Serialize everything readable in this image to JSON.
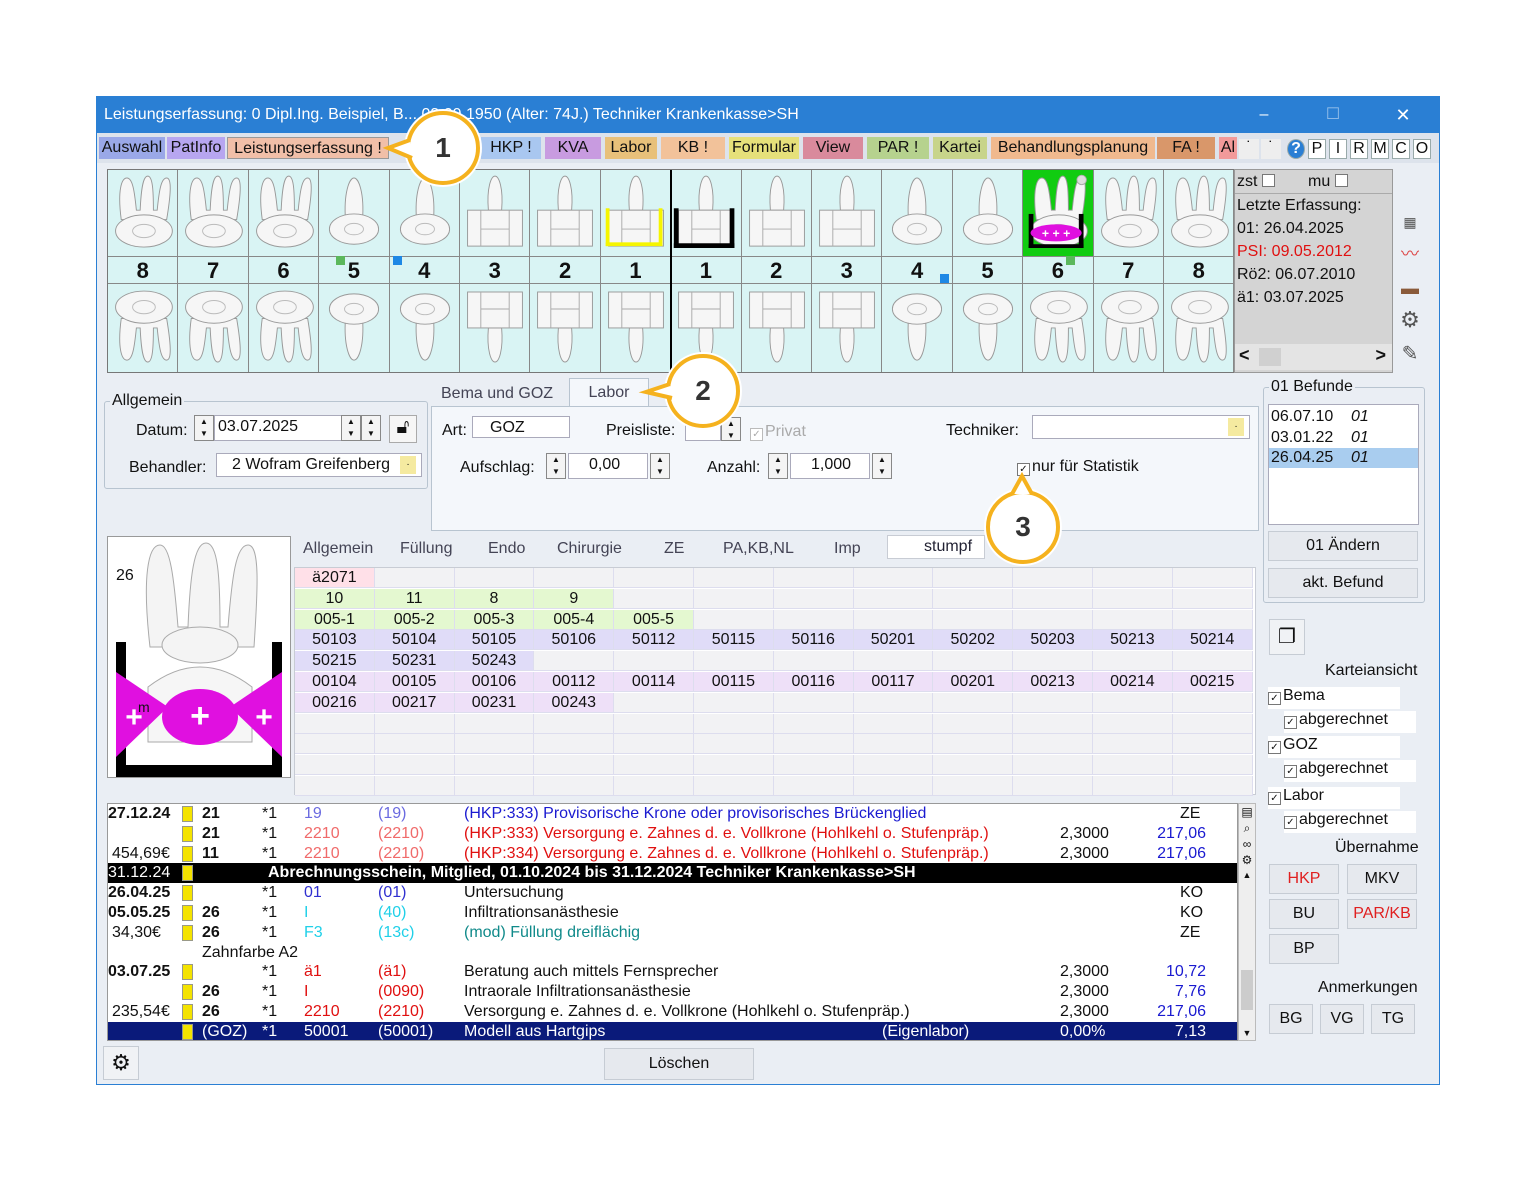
{
  "window": {
    "title": "Leistungserfassung: 0  Dipl.Ing. Beispiel, B... 03.09.1950 (Alter: 74J.)  Techniker Krankenkasse>SH",
    "min": "–",
    "max": "☐",
    "close": "✕"
  },
  "tabs": [
    {
      "label": "Auswahl",
      "color": "#9aa8e8"
    },
    {
      "label": "PatInfo",
      "color": "#b7a6f0"
    },
    {
      "label": "Leistungserfassung !",
      "color": "#f1bfa8"
    },
    {
      "label": "HKP !",
      "color": "#a9c7f0"
    },
    {
      "label": "KVA",
      "color": "#c89be0"
    },
    {
      "label": "Labor",
      "color": "#e8c07a"
    },
    {
      "label": "KB !",
      "color": "#f2c29a"
    },
    {
      "label": "Formular",
      "color": "#e6e07a"
    },
    {
      "label": "View",
      "color": "#d98a9c"
    },
    {
      "label": "PAR !",
      "color": "#b6d28e"
    },
    {
      "label": "Kartei",
      "color": "#c8d48a"
    },
    {
      "label": "Behandlungsplanung",
      "color": "#f0b98e"
    },
    {
      "label": "FA !",
      "color": "#d9976a"
    },
    {
      "label": "Al",
      "color": "#f29a9a"
    }
  ],
  "tab_small": [
    "˙",
    "˙"
  ],
  "tab_right": [
    "?",
    "P",
    "I",
    "R",
    "M",
    "C",
    "O"
  ],
  "teeth": {
    "upper_numbers": [
      "8",
      "7",
      "6",
      "5",
      "4",
      "3",
      "2",
      "1",
      "1",
      "2",
      "3",
      "4",
      "5",
      "6",
      "7",
      "8"
    ],
    "selected_index": 13,
    "marker_colors": {
      "green": "#5cb85c",
      "blue": "#1e88e5",
      "selected_bg": "#11cc11",
      "bridge_yellow": "#f5f500",
      "restoration_magenta": "#e010e0"
    }
  },
  "info": {
    "zst": "zst",
    "mu": "mu",
    "line1": "Letzte Erfassung:",
    "line2": "01: 26.04.2025",
    "line3": "PSI: 09.05.2012",
    "line4": "Rö2: 06.07.2010",
    "line5": "ä1: 03.07.2025",
    "scroll_left": "<",
    "scroll_right": ">"
  },
  "allgemein": {
    "title": "Allgemein",
    "datum_label": "Datum:",
    "datum_value": "03.07.2025",
    "behandler_label": "Behandler:",
    "behandler_value": "2 Wofram Greifenberg"
  },
  "subtabs": {
    "bema_goz": "Bema und GOZ",
    "labor": "Labor"
  },
  "labor": {
    "art_label": "Art:",
    "art_value": "GOZ",
    "preisliste_label": "Preisliste:",
    "privat_label": "Privat",
    "techniker_label": "Techniker:",
    "aufschlag_label": "Aufschlag:",
    "aufschlag_value": "0,00",
    "anzahl_label": "Anzahl:",
    "anzahl_value": "1,000",
    "statistik_label": "nur für Statistik"
  },
  "tooth_preview": {
    "number": "26",
    "surface": "m"
  },
  "code_tabs": [
    "Allgemein",
    "Füllung",
    "Endo",
    "Chirurgie",
    "ZE",
    "PA,KB,NL",
    "Imp",
    "stumpf"
  ],
  "code_grid": [
    {
      "bg": "#ffe0e8",
      "cells": [
        "ä2071"
      ]
    },
    {
      "bg": "#e4f8d0",
      "cells": [
        "10",
        "11",
        "8",
        "9"
      ]
    },
    {
      "bg": "#e4f8d0",
      "cells": [
        "005-1",
        "005-2",
        "005-3",
        "005-4",
        "005-5"
      ]
    },
    {
      "bg": "#e0dcf8",
      "cells": [
        "50103",
        "50104",
        "50105",
        "50106",
        "50112",
        "50115",
        "50116",
        "50201",
        "50202",
        "50203",
        "50213",
        "50214"
      ]
    },
    {
      "bg": "#e0dcf8",
      "cells": [
        "50215",
        "50231",
        "50243"
      ]
    },
    {
      "bg": "#eee0f8",
      "cells": [
        "00104",
        "00105",
        "00106",
        "00112",
        "00114",
        "00115",
        "00116",
        "00117",
        "00201",
        "00213",
        "00214",
        "00215"
      ]
    },
    {
      "bg": "#eee0f8",
      "cells": [
        "00216",
        "00217",
        "00231",
        "00243"
      ]
    }
  ],
  "befunde": {
    "title": "01 Befunde",
    "items": [
      {
        "date": "06.07.10",
        "code": "01"
      },
      {
        "date": "03.01.22",
        "code": "01"
      },
      {
        "date": "26.04.25",
        "code": "01"
      }
    ],
    "btn_aendern": "01 Ändern",
    "btn_akt": "akt. Befund"
  },
  "karteiansicht": {
    "title": "Karteiansicht",
    "bema": "Bema",
    "bema_abg": "abgerechnet",
    "goz": "GOZ",
    "goz_abg": "abgerechnet",
    "labor": "Labor",
    "labor_abg": "abgerechnet"
  },
  "uebernahme": {
    "title": "Übernahme",
    "hkp": "HKP",
    "mkv": "MKV",
    "bu": "BU",
    "parkb": "PAR/KB",
    "bp": "BP"
  },
  "anmerkungen": {
    "title": "Anmerkungen",
    "bg": "BG",
    "vg": "VG",
    "tg": "TG"
  },
  "journal": [
    {
      "date": "27.12.24",
      "tooth": "21",
      "qty": "*1",
      "code": "19",
      "code2": "(19)",
      "text": "(HKP:333) Provisorische Krone oder provisorisches Brückenglied",
      "factor": "",
      "amount": "",
      "type": "ZE",
      "style": "blue"
    },
    {
      "date": "",
      "tooth": "21",
      "qty": "*1",
      "code": "2210",
      "code2": "(2210)",
      "text": "(HKP:333) Versorgung e. Zahnes d. e. Vollkrone (Hohlkehl o. Stufenpräp.)",
      "factor": "2,3000",
      "amount": "217,06",
      "type": "",
      "style": "red"
    },
    {
      "date": "454,69€",
      "tooth": "11",
      "qty": "*1",
      "code": "2210",
      "code2": "(2210)",
      "text": "(HKP:334) Versorgung e. Zahnes d. e. Vollkrone (Hohlkehl o. Stufenpräp.)",
      "factor": "2,3000",
      "amount": "217,06",
      "type": "",
      "style": "red"
    },
    {
      "date": "31.12.24",
      "tooth": "",
      "qty": "",
      "code": "",
      "code2": "",
      "text": "Abrechnungsschein, Mitglied, 01.10.2024 bis 31.12.2024  Techniker Krankenkasse>SH",
      "factor": "",
      "amount": "",
      "type": "",
      "style": "header"
    },
    {
      "date": "26.04.25",
      "tooth": "",
      "qty": "*1",
      "code": "01",
      "code2": "(01)",
      "text": "Untersuchung",
      "factor": "",
      "amount": "",
      "type": "KO",
      "style": "bluecode"
    },
    {
      "date": "05.05.25",
      "tooth": "26",
      "qty": "*1",
      "code": "I",
      "code2": "(40)",
      "text": "Infiltrationsanästhesie",
      "factor": "",
      "amount": "",
      "type": "KO",
      "style": "cyancode"
    },
    {
      "date": "34,30€",
      "tooth": "26",
      "qty": "*1",
      "code": "F3",
      "code2": "(13c)",
      "text": "(mod) Füllung dreiflächig",
      "factor": "",
      "amount": "",
      "type": "ZE",
      "style": "teal"
    },
    {
      "date": "",
      "tooth": "Zahnfarbe A2",
      "qty": "",
      "code": "",
      "code2": "",
      "text": "",
      "factor": "",
      "amount": "",
      "type": "",
      "style": "note"
    },
    {
      "date": "03.07.25",
      "tooth": "",
      "qty": "*1",
      "code": "ä1",
      "code2": "(ä1)",
      "text": "Beratung auch mittels Fernsprecher",
      "factor": "2,3000",
      "amount": "10,72",
      "type": "",
      "style": "redcode"
    },
    {
      "date": "",
      "tooth": "26",
      "qty": "*1",
      "code": "I",
      "code2": "(0090)",
      "text": "Intraorale Infiltrationsanästhesie",
      "factor": "2,3000",
      "amount": "7,76",
      "type": "",
      "style": "redcode"
    },
    {
      "date": "235,54€",
      "tooth": "26",
      "qty": "*1",
      "code": "2210",
      "code2": "(2210)",
      "text": "Versorgung e. Zahnes d. e. Vollkrone (Hohlkehl o. Stufenpräp.)",
      "factor": "2,3000",
      "amount": "217,06",
      "type": "",
      "style": "redcode"
    },
    {
      "date": "",
      "tooth": "(GOZ)",
      "qty": "*1",
      "code": "50001",
      "code2": "(50001)",
      "text": "Modell aus Hartgips",
      "note": "(Eigenlabor)",
      "factor": "0,00%",
      "amount": "7,13",
      "type": "",
      "style": "selected"
    }
  ],
  "footer": {
    "loeschen": "Löschen"
  },
  "callouts": [
    "1",
    "2",
    "3"
  ]
}
